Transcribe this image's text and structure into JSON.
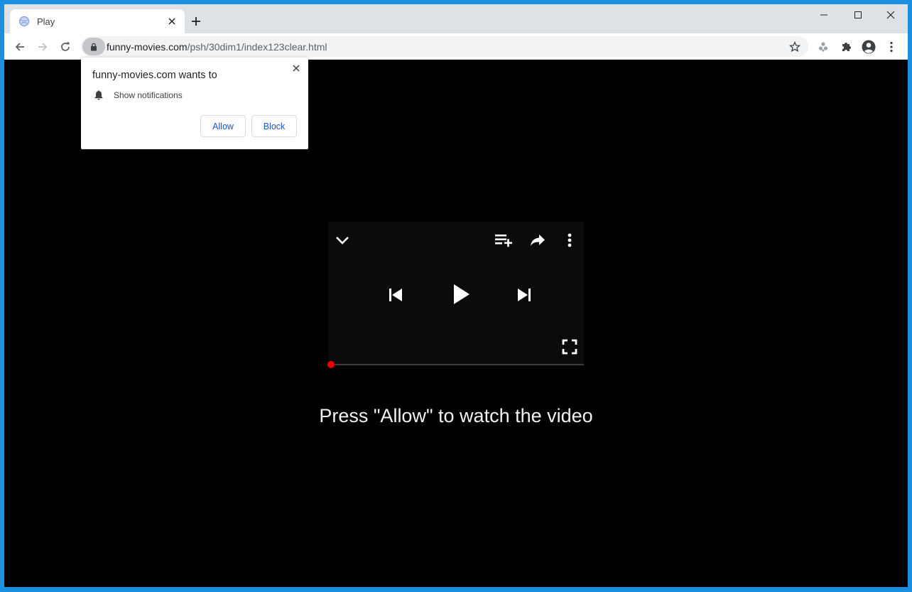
{
  "browser": {
    "tab": {
      "title": "Play",
      "favicon": "globe-icon"
    },
    "new_tab_icon": "plus-icon",
    "window_controls": [
      "minimize-icon",
      "maximize-icon",
      "close-icon"
    ],
    "address_bar": {
      "host": "funny-movies.com",
      "path": "/psh/30dim1/index123clear.html",
      "security_icon": "lock-icon"
    },
    "toolbar_icons": [
      "star-icon",
      "extension-alt-icon",
      "puzzle-icon",
      "profile-icon",
      "kebab-menu-icon"
    ]
  },
  "permission_prompt": {
    "heading": "funny-movies.com wants to",
    "request": "Show notifications",
    "request_icon": "bell-icon",
    "allow_label": "Allow",
    "block_label": "Block",
    "accent_color": "#1a56c4"
  },
  "player": {
    "progress": 0.0,
    "progress_color": "#ff0000",
    "icons": [
      "chevron-down-icon",
      "playlist-add-icon",
      "share-icon",
      "more-vert-icon",
      "skip-previous-icon",
      "play-icon",
      "skip-next-icon",
      "fullscreen-icon"
    ]
  },
  "page": {
    "message": "Press \"Allow\" to watch the video"
  }
}
